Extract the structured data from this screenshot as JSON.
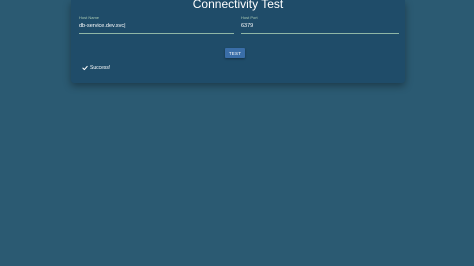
{
  "page": {
    "title": "Connectivity Test"
  },
  "form": {
    "host": {
      "label": "Host Name",
      "value": "db-service.dev.svc|"
    },
    "port": {
      "label": "Host Port",
      "value": "6379"
    },
    "test_button_label": "TEST"
  },
  "status": {
    "icon": "check-icon",
    "text": "Success!"
  },
  "colors": {
    "background": "#2b5a72",
    "card": "#1f4c69",
    "button": "#3a6ea8",
    "label": "#a9c9b3"
  }
}
